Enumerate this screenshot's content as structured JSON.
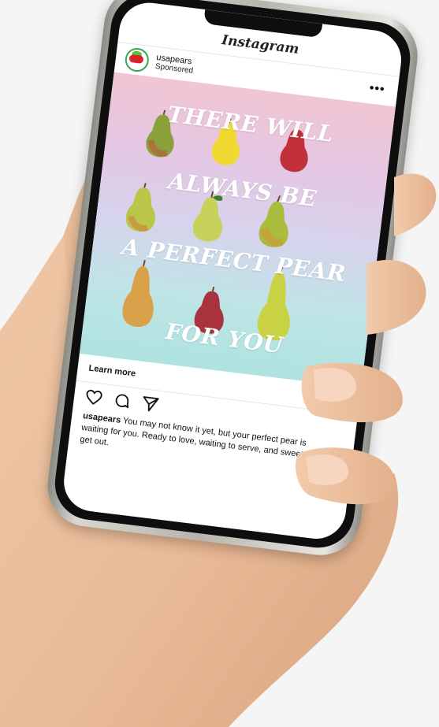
{
  "app": {
    "title": "Instagram"
  },
  "post": {
    "username": "usapears",
    "sponsored_label": "Sponsored",
    "more_label": "•••",
    "headline": [
      "THERE WILL",
      "ALWAYS BE",
      "A PERFECT PEAR",
      "FOR YOU"
    ],
    "cta_label": "Learn more",
    "caption_user": "usapears",
    "caption_text": " You may not know it yet, but your perfect pear is waiting for you. Ready to love, waiting to serve, and sweet as all get out."
  },
  "icons": {
    "like": "heart-icon",
    "comment": "comment-icon",
    "share": "send-icon",
    "more": "more-dots-icon"
  },
  "colors": {
    "accent_green": "#34a853",
    "brand_red": "#d8232a",
    "headline_text": "#ffffff"
  }
}
